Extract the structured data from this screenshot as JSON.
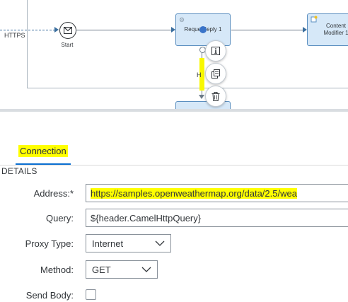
{
  "flow": {
    "adapter_label": "HTTPS",
    "start_label": "Start",
    "request_reply_label": "Reque  Reply 1",
    "content_modifier_label": "Content Modifier 1",
    "connector_label": "H",
    "quick_actions": [
      "info-icon",
      "copy-icon",
      "delete-icon"
    ],
    "accent_color": "#0a6ed1",
    "step_fill_color": "#d6e8f8",
    "highlight_color": "#ffff00"
  },
  "panel": {
    "tab_label": "Connection",
    "section_title": "DETAILS",
    "address": {
      "label": "Address:",
      "required_marker": "*",
      "value": "https://samples.openweathermap.org/data/2.5/wea"
    },
    "query": {
      "label": "Query:",
      "value": "${header.CamelHttpQuery}"
    },
    "proxy_type": {
      "label": "Proxy Type:",
      "value": "Internet"
    },
    "method": {
      "label": "Method:",
      "value": "GET"
    },
    "send_body": {
      "label": "Send Body:",
      "checked": false
    }
  }
}
